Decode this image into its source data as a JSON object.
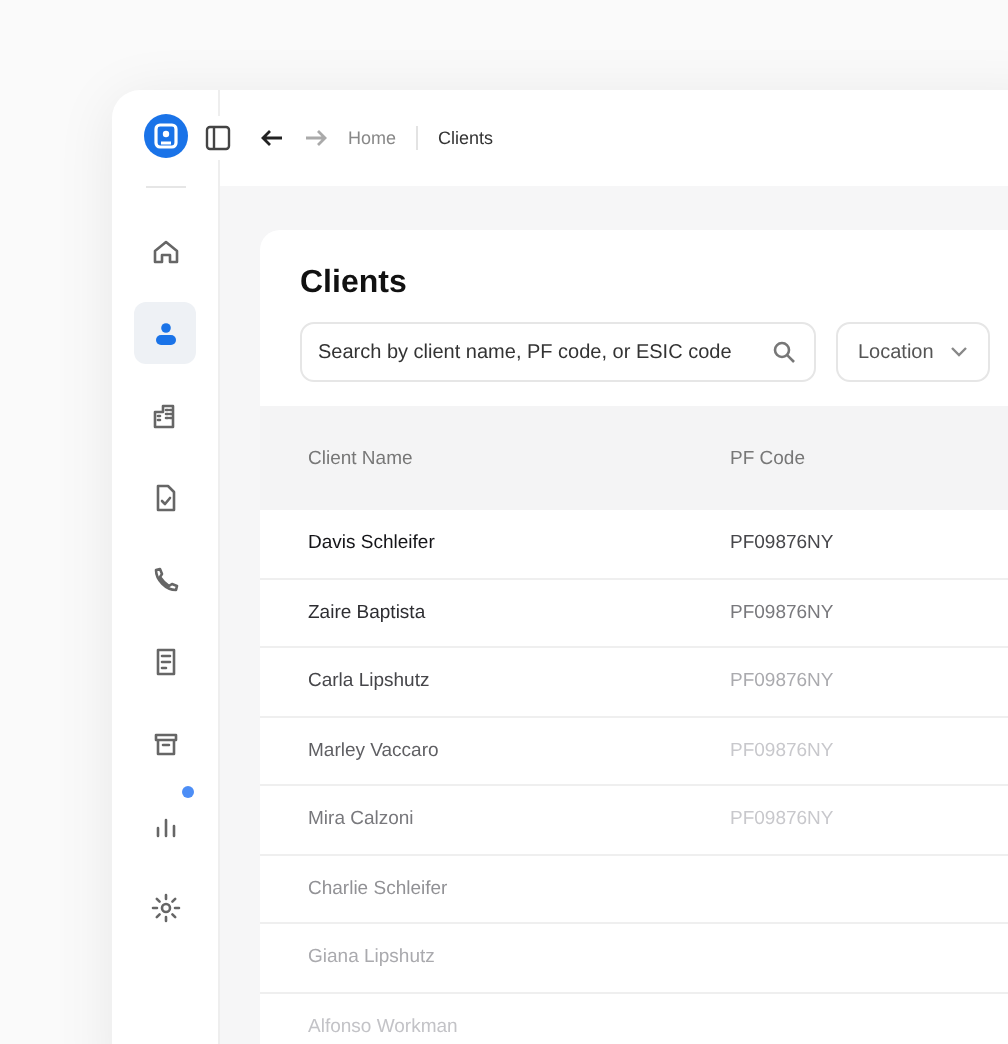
{
  "sidebar": {
    "items": [
      {
        "selected": false,
        "dot": false
      },
      {
        "selected": true,
        "dot": false
      },
      {
        "selected": false,
        "dot": false
      },
      {
        "selected": false,
        "dot": false
      },
      {
        "selected": false,
        "dot": false
      },
      {
        "selected": false,
        "dot": false
      },
      {
        "selected": false,
        "dot": false
      },
      {
        "selected": false,
        "dot": true
      },
      {
        "selected": false,
        "dot": false
      }
    ]
  },
  "breadcrumb": [
    "Home",
    "Clients"
  ],
  "page_title": "Clients",
  "search": {
    "placeholder": "Search by client name, PF code, or ESIC code"
  },
  "filter": {
    "label": "Location"
  },
  "table": {
    "columns": [
      "Client Name",
      "PF Code"
    ],
    "rows": [
      [
        "Davis Schleifer",
        "PF09876NY"
      ],
      [
        "Zaire Baptista",
        "PF09876NY"
      ],
      [
        "Carla Lipshutz",
        "PF09876NY"
      ],
      [
        "Marley Vaccaro",
        "PF09876NY"
      ],
      [
        "Mira Calzoni",
        "PF09876NY"
      ],
      [
        "Charlie Schleifer"
      ],
      [
        "Giana Lipshutz"
      ],
      [
        "Alfonso Workman"
      ]
    ]
  }
}
